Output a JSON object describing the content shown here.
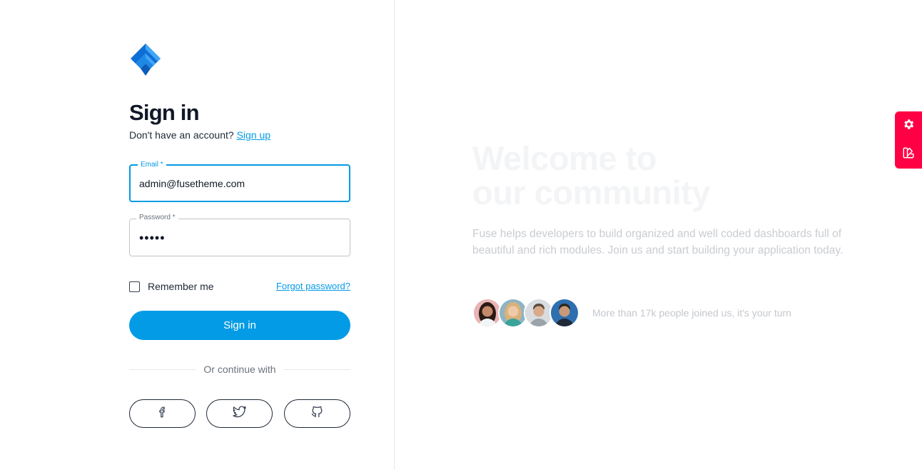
{
  "logo": {
    "icon": "fuse-logo-icon",
    "colors": [
      "#0b65c6",
      "#1e88e5",
      "#42a5f5"
    ]
  },
  "signin": {
    "title": "Sign in",
    "no_account_text": "Don't have an account?",
    "signup_link": "Sign up",
    "email_label": "Email *",
    "email_value": "admin@fusetheme.com",
    "password_label": "Password *",
    "password_value": "admin",
    "remember_label": "Remember me",
    "remember_checked": false,
    "forgot_link": "Forgot password?",
    "submit_label": "Sign in",
    "divider_text": "Or continue with",
    "social": [
      {
        "name": "facebook",
        "icon": "facebook-icon"
      },
      {
        "name": "twitter",
        "icon": "twitter-icon"
      },
      {
        "name": "github",
        "icon": "github-icon"
      }
    ]
  },
  "hero": {
    "title_line1": "Welcome to",
    "title_line2": "our community",
    "description": "Fuse helps developers to build organized and well coded dashboards full of beautiful and rich modules. Join us and start building your application today.",
    "joined_text": "More than 17k people joined us, it's your turn",
    "avatars": [
      "avatar-1",
      "avatar-2",
      "avatar-3",
      "avatar-4"
    ]
  },
  "floating_panel": {
    "color": "#ff0044",
    "buttons": [
      {
        "icon": "gear-icon"
      },
      {
        "icon": "palette-swatch-icon"
      }
    ]
  },
  "theme": {
    "accent": "#039be5"
  }
}
